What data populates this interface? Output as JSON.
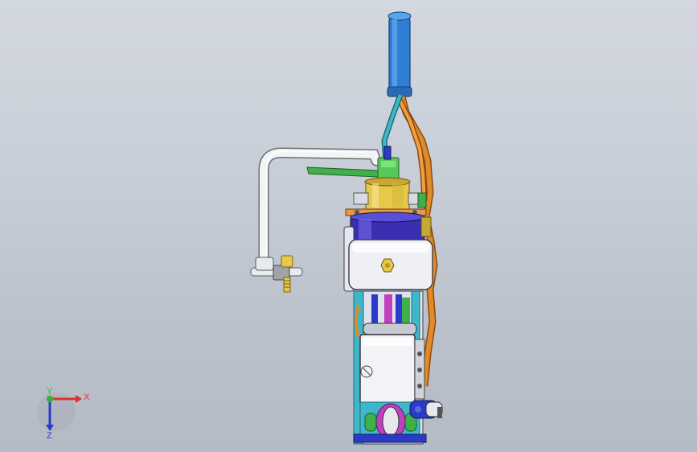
{
  "viewport": {
    "background_top": "#d3d8e0",
    "background_bottom": "#b5bbc5"
  },
  "model": {
    "colors": {
      "tube_blue": "#2f7fd6",
      "pipe_white": "#f2f4f6",
      "orange": "#e08a2a",
      "cyan": "#3fb7c9",
      "green": "#3fb04a",
      "yellow": "#e6c84a",
      "purple": "#3a2fb0",
      "body_white": "#eef0f6",
      "magenta": "#c040c0"
    }
  },
  "triad": {
    "x_label": "X",
    "y_label": "Y",
    "z_label": "Z",
    "x_color": "#e0302a",
    "y_color": "#38b038",
    "z_color": "#2a3aca"
  }
}
